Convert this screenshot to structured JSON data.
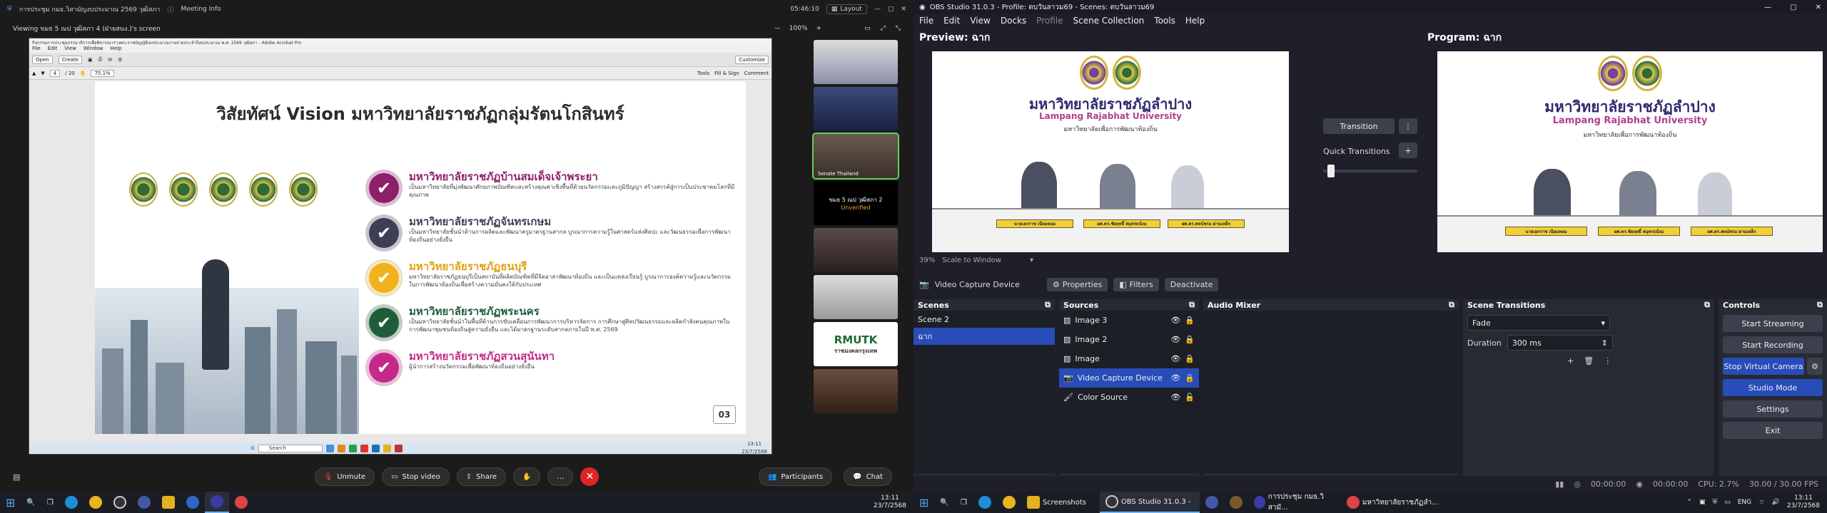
{
  "zoom": {
    "title": "การประชุม กมธ.วิสามัญงบประมาณ 2569 วุฒิสภา",
    "meeting_info": "Meeting Info",
    "timer": "05:46:10",
    "layout": "Layout",
    "viewing": "Viewing ขมธ 5 ณป วุฒิสภา 4 (ฝ่ายสนง.)'s screen",
    "zoom_level": "100%",
    "acrobat": {
      "title": "กิจกรรมการประชุมกรรมาธิการเพื่อพิจารณาร่างพระราชบัญญัติงบประมาณรายจ่ายประจำปีงบประมาณ พ.ศ. 2569 วุฒิสภา - Adobe Acrobat Pro",
      "menus": [
        "File",
        "Edit",
        "View",
        "Window",
        "Help"
      ],
      "open": "Open",
      "create": "Create",
      "customize": "Customize",
      "page": "4",
      "page_total": "/ 20",
      "zoom": "75.1%",
      "tools": "Tools",
      "fill_sign": "Fill & Sign",
      "comment": "Comment"
    },
    "slide": {
      "title": "วิสัยทัศน์ Vision มหาวิทยาลัยราชภัฏกลุ่มรัตนโกสินทร์",
      "items": [
        {
          "icon": "✔",
          "color": "#8e1f6a",
          "title": "มหาวิทยาลัยราชภัฏบ้านสมเด็จเจ้าพระยา",
          "desc": "เป็นมหาวิทยาลัยที่มุ่งพัฒนาศักยภาพบัณฑิตและสร้างคุณค่าเชิงพื้นที่ด้วยนวัตกรรมและภูมิปัญญา สร้างสรรค์สู่การเป็นประชาคมโลกที่มีคุณภาพ"
        },
        {
          "icon": "✔",
          "color": "#3d3f55",
          "title": "มหาวิทยาลัยราชภัฏจันทรเกษม",
          "desc": "เป็นมหาวิทยาลัยชั้นนำด้านการผลิตและพัฒนาครูมาตรฐานสากล บูรณาการความรู้ในศาสตร์แห่งศิลปะ และวัฒนธรรมเพื่อการพัฒนาท้องถิ่นอย่างยั่งยืน"
        },
        {
          "icon": "✔",
          "color": "#f0b21d",
          "title": "มหาวิทยาลัยราชภัฏธนบุรี",
          "desc": "มหาวิทยาลัยราชภัฏธนบุรีเป็นสถาบันที่ผลิตบัณฑิตที่มีจิตอาสาพัฒนาท้องถิ่น และเป็นแหล่งเรียนรู้ บูรณาการองค์ความรู้และนวัตกรรมในการพัฒนาท้องถิ่นเพื่อสร้างความมั่นคงให้กับประเทศ"
        },
        {
          "icon": "✔",
          "color": "#1f5d3a",
          "title": "มหาวิทยาลัยราชภัฏพระนคร",
          "desc": "เป็นมหาวิทยาลัยชั้นนำในพื้นที่ด้านการขับเคลื่อนการพัฒนาการบริหารจัดการ การศึกษาสู่ศิลปวัฒนธรรมและผลิตกำลังคนคุณภาพในการพัฒนาชุมชนท้องถิ่นสู่ความยั่งยืน และได้มาตรฐานระดับสากลภายในปี พ.ศ. 2569"
        },
        {
          "icon": "✔",
          "color": "#c42a8a",
          "title": "มหาวิทยาลัยราชภัฏสวนสุนันทา",
          "desc": "ผู้นำการสร้างนวัตกรรมเพื่อพัฒนาท้องถิ่นอย่างยั่งยืน"
        }
      ],
      "page": "03"
    },
    "inner_taskbar": {
      "search": "Search",
      "time": "13:11",
      "date": "23/7/2568"
    },
    "thumbs": {
      "label3": "Senate Thailand",
      "black_title": "ขมธ 5 ณป วุฒิสภา 2",
      "black_sub": "Unverified",
      "logo": "RMUTK",
      "logo_sub": "ราชมงคลกรุงเทพ"
    },
    "controls": {
      "unmute": "Unmute",
      "stop_video": "Stop video",
      "share": "Share",
      "participants": "Participants",
      "chat": "Chat"
    }
  },
  "obs": {
    "title": "OBS Studio 31.0.3 - Profile: ตบวันลาวม69 - Scenes: ตบวันลาวม69",
    "menus": [
      "File",
      "Edit",
      "View",
      "Docks",
      "Profile",
      "Scene Collection",
      "Tools",
      "Help"
    ],
    "preview_label": "Preview: ฉาก",
    "program_label": "Program: ฉาก",
    "preview_zoom": "39%",
    "scale": "Scale to Window",
    "stage": {
      "uni_thai": "มหาวิทยาลัยราชภัฏลำปาง",
      "uni_en": "Lampang Rajabhat University",
      "motto": "มหาวิทยาลัยเพื่อการพัฒนาท้องถิ่น",
      "names": [
        "นายเอกราช เนียมหอม",
        "ผศ.ดร.ชัยฤทธิ์ สมุทรธนั่งม",
        "ผศ.ดร.พจน์ชรม ผ่านเหล็ก"
      ]
    },
    "transition": "Transition",
    "quick_transitions": "Quick Transitions",
    "transition_fill": 0.05,
    "source_bar": {
      "name": "Video Capture Device",
      "properties": "Properties",
      "filters": "Filters",
      "deactivate": "Deactivate"
    },
    "scenes": {
      "header": "Scenes",
      "items": [
        "Scene 2",
        "ฉาก"
      ]
    },
    "sources": {
      "header": "Sources",
      "items": [
        "Image 3",
        "Image 2",
        "Image",
        "Video Capture Device",
        "Color Source"
      ]
    },
    "audio": {
      "header": "Audio Mixer"
    },
    "transitions": {
      "header": "Scene Transitions",
      "type": "Fade",
      "duration_label": "Duration",
      "duration": "300 ms"
    },
    "controls": {
      "header": "Controls",
      "items": [
        "Start Streaming",
        "Start Recording",
        "Stop Virtual Camera",
        "Studio Mode",
        "Settings",
        "Exit"
      ]
    },
    "status": {
      "t1": "00:00:00",
      "t2": "00:00:00",
      "cpu": "CPU: 2.7%",
      "fps": "30.00 / 30.00 FPS"
    }
  },
  "taskbar_right": {
    "items": [
      "Screenshots",
      "OBS Studio 31.0.3 -",
      "การประชุม กมธ.วิสามั...",
      "มหาวิทยาลัยราชภัฏลำ..."
    ],
    "lang": "ENG",
    "time": "13:11",
    "date": "23/7/2568"
  },
  "taskbar_left": {
    "time": "13:11",
    "date": "23/7/2568"
  }
}
